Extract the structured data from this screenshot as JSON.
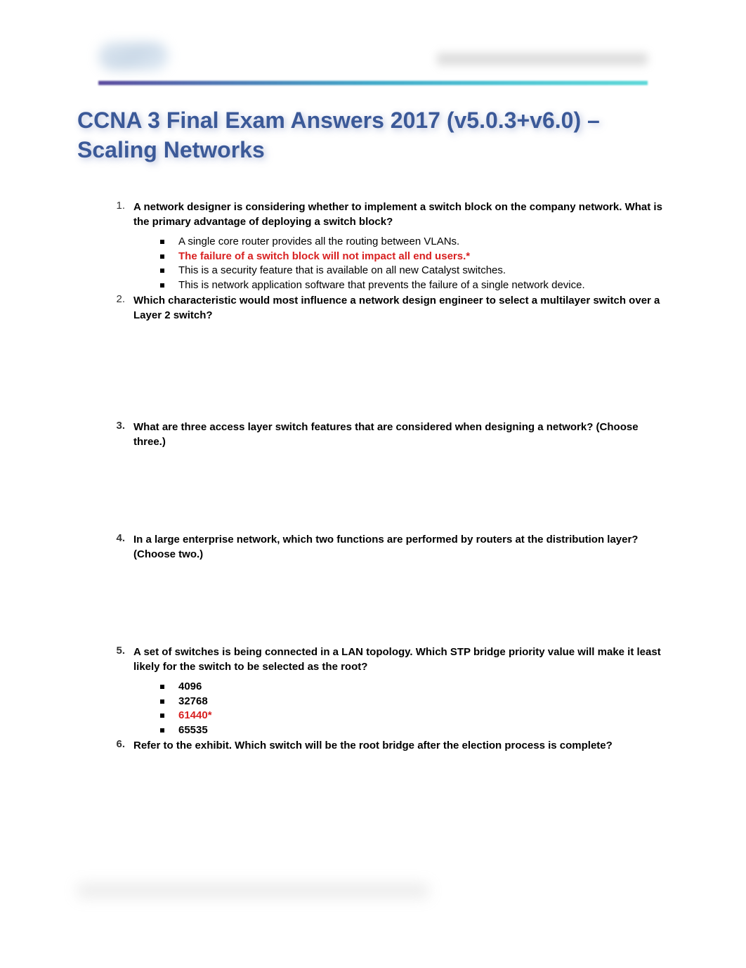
{
  "title": "CCNA 3 Final Exam Answers 2017 (v5.0.3+v6.0) – Scaling Networks",
  "questions": [
    {
      "number": "1.",
      "numberBold": false,
      "text": "A network designer is considering whether to implement a switch block on the company network. What is the primary advantage of deploying a switch block?",
      "answers": [
        {
          "text": "A single core router provides all the routing between VLANs.",
          "correct": false,
          "bold": false
        },
        {
          "text": "The failure of a switch block will not impact all end users.*",
          "correct": true,
          "bold": true
        },
        {
          "text": "This is a security feature that is available on all new Catalyst switches.",
          "correct": false,
          "bold": false
        },
        {
          "text": "This is network application software that prevents the failure of a single network device.",
          "correct": false,
          "bold": false
        }
      ],
      "spacerAfter": false
    },
    {
      "number": "2.",
      "numberBold": false,
      "text": "Which characteristic would most influence a network design engineer to select a multilayer switch over a Layer 2 switch?",
      "answers": [],
      "spacerAfter": true
    },
    {
      "number": "3.",
      "numberBold": true,
      "text": "What are three access layer switch features that are considered when designing a network? (Choose three.)",
      "answers": [],
      "spacerAfter": true
    },
    {
      "number": "4.",
      "numberBold": true,
      "text": "In a large enterprise network, which two functions are performed by routers at the distribution layer? (Choose two.)",
      "answers": [],
      "spacerAfter": true
    },
    {
      "number": "5.",
      "numberBold": true,
      "text": "A set of switches is being connected in a LAN topology. Which STP bridge priority value will make it least likely for the switch to be selected as the root?",
      "answers": [
        {
          "text": "4096",
          "correct": false,
          "bold": true
        },
        {
          "text": "32768",
          "correct": false,
          "bold": true
        },
        {
          "text": "61440*",
          "correct": true,
          "bold": true
        },
        {
          "text": "65535",
          "correct": false,
          "bold": true
        }
      ],
      "spacerAfter": false
    },
    {
      "number": "6.",
      "numberBold": true,
      "text": "Refer to the exhibit. Which switch will be the root bridge after the election process is complete?",
      "answers": [],
      "spacerAfter": false
    }
  ]
}
